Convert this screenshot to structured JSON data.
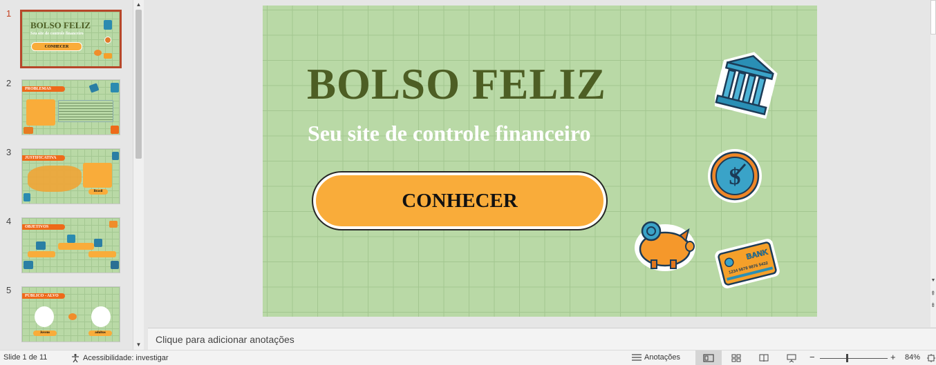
{
  "thumbnails": [
    {
      "number": "1",
      "title": "BOLSO FELIZ",
      "subtitle": "Seu site de controle financeiro",
      "button": "CONHECER"
    },
    {
      "number": "2",
      "tag": "PROBLEMAS"
    },
    {
      "number": "3",
      "tag": "JUSTIFICATIVA",
      "chip": "Brasil"
    },
    {
      "number": "4",
      "tag": "OBJETIVOS"
    },
    {
      "number": "5",
      "tag": "PÚBLICO - ALVO",
      "chip_left": "Jovens",
      "chip_right": "adultos"
    }
  ],
  "slide": {
    "title": "BOLSO FELIZ",
    "subtitle": "Seu site de controle financeiro",
    "button": "CONHECER",
    "card_label": "BANK",
    "card_number": "1234 5678 9876 5432"
  },
  "notes": {
    "placeholder": "Clique para adicionar anotações"
  },
  "statusbar": {
    "slide_info": "Slide 1 de 11",
    "accessibility": "Acessibilidade: investigar",
    "notes_button": "Anotações",
    "zoom_minus": "−",
    "zoom_plus": "+",
    "zoom_percent": "84%"
  },
  "colors": {
    "slide_bg": "#b9d9a6",
    "title": "#4d5e24",
    "button": "#f9ac3a",
    "tag": "#ee6a1a",
    "active_thumb": "#b7472a"
  },
  "icons": [
    "bank-building-icon",
    "dollar-coin-icon",
    "piggy-bank-icon",
    "bank-card-icon",
    "accessibility-icon",
    "notes-icon",
    "normal-view-icon",
    "slide-sorter-icon",
    "reading-view-icon",
    "presenter-view-icon",
    "fit-slide-icon"
  ]
}
